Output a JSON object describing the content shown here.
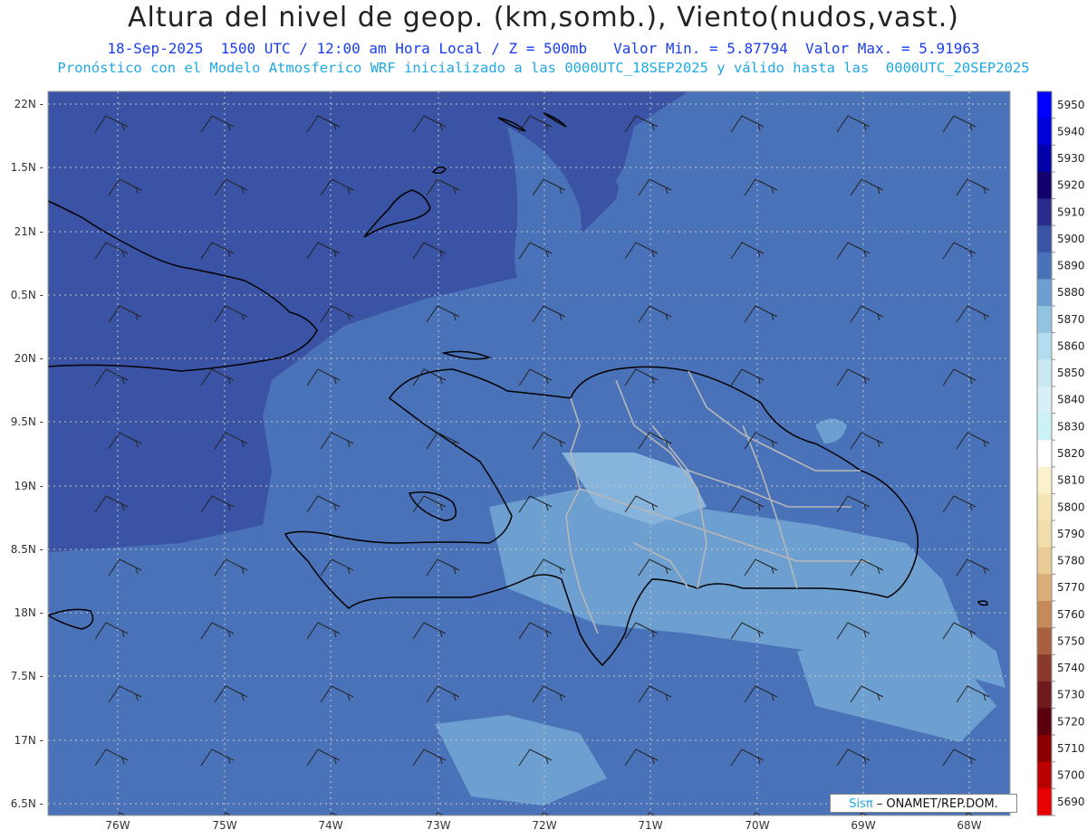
{
  "header": {
    "title": "Altura del nivel de geop. (km,somb.), Viento(nudos,vast.)",
    "subtitle_line1": "18-Sep-2025  1500 UTC / 12:00 am Hora Local / Z = 500mb   Valor Min. = 5.87794  Valor Max. = 5.91963",
    "subtitle_line2": "Pronóstico con el Modelo Atmosferico WRF inicializado a las 0000UTC_18SEP2025 y válido hasta las  0000UTC_20SEP2025"
  },
  "map": {
    "lat_labels": [
      "22N",
      "1.5N",
      "21N",
      "0.5N",
      "20N",
      "9.5N",
      "19N",
      "8.5N",
      "18N",
      "7.5N",
      "17N",
      "6.5N"
    ],
    "lon_labels": [
      "76W",
      "75W",
      "74W",
      "73W",
      "72W",
      "71W",
      "70W",
      "69W",
      "68W"
    ],
    "fill_colors": {
      "dark": "#3a53a4",
      "mid": "#4a72b8",
      "light": "#6d9fd0",
      "lightest": "#86b4dc"
    }
  },
  "colorbar": {
    "levels": [
      "5950",
      "5940",
      "5930",
      "5920",
      "5910",
      "5900",
      "5890",
      "5880",
      "5870",
      "5860",
      "5850",
      "5840",
      "5830",
      "5820",
      "5810",
      "5800",
      "5790",
      "5780",
      "5770",
      "5760",
      "5750",
      "5740",
      "5730",
      "5720",
      "5710",
      "5700",
      "5690"
    ],
    "colors": [
      "#0000ff",
      "#0000d8",
      "#0000a8",
      "#14006a",
      "#2a2a8c",
      "#3a53a4",
      "#4a72b8",
      "#6d9fd0",
      "#92c4e2",
      "#b3dcee",
      "#c8e8f2",
      "#d8eff6",
      "#ccf2f5",
      "#ffffff",
      "#fbf2cc",
      "#f6e6b6",
      "#f1dcac",
      "#e8cb96",
      "#d9ad77",
      "#c58a59",
      "#a8603f",
      "#8a3a2c",
      "#6e1b1e",
      "#5a0010",
      "#8a0000",
      "#bb0000",
      "#e80000"
    ]
  },
  "credit": {
    "sis": "Sisπ",
    "rest": " – ONAMET/REP.DOM."
  }
}
